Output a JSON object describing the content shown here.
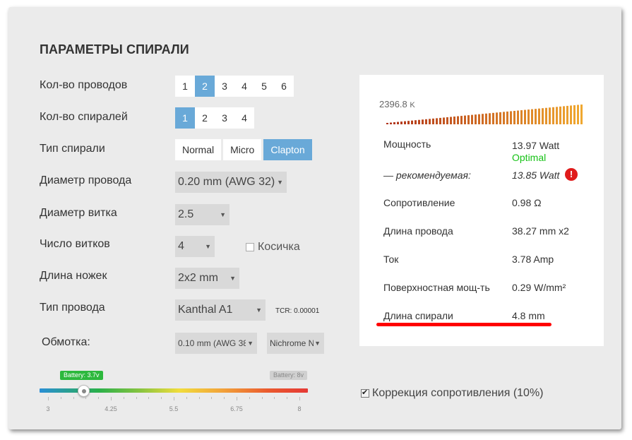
{
  "title": "ПАРАМЕТРЫ СПИРАЛИ",
  "rows": {
    "wires": {
      "label": "Кол-во проводов",
      "options": [
        "1",
        "2",
        "3",
        "4",
        "5",
        "6"
      ],
      "selected": "2"
    },
    "coils": {
      "label": "Кол-во спиралей",
      "options": [
        "1",
        "2",
        "3",
        "4"
      ],
      "selected": "1"
    },
    "coil_type": {
      "label": "Тип спирали",
      "options": [
        "Normal",
        "Micro",
        "Clapton"
      ],
      "selected": "Clapton"
    },
    "wire_diameter": {
      "label": "Диаметр провода",
      "value": "0.20 mm (AWG 32)"
    },
    "coil_diameter": {
      "label": "Диаметр витка",
      "value": "2.5"
    },
    "turns": {
      "label": "Число витков",
      "value": "4"
    },
    "legs": {
      "label": "Длина ножек",
      "value": "2x2 mm"
    },
    "wire_type": {
      "label": "Тип провода",
      "value": "Kanthal A1",
      "tcr": "TCR: 0.00001"
    },
    "wrap": {
      "label": "Обмотка:",
      "diameter": "0.10 mm (AWG 38",
      "material": "Nichrome N"
    }
  },
  "braid": {
    "label": "Косичка",
    "checked": false
  },
  "battery": {
    "current_label": "Battery: 3.7v",
    "max_label": "Battery: 8v",
    "ticks": [
      "3",
      "4.25",
      "5.5",
      "6.75",
      "8"
    ],
    "min": 3,
    "max": 8,
    "value": 3.7
  },
  "correction": {
    "label": "Коррекция сопротивления (10%)",
    "checked": true
  },
  "results": {
    "chart_max_value": "2396.8",
    "chart_max_unit": "K",
    "power": {
      "label": "Мощность",
      "value": "13.97 Watt",
      "status": "Optimal"
    },
    "recommended": {
      "label": "— рекомендуемая:",
      "value": "13.85 Watt",
      "warn": "!"
    },
    "resistance": {
      "label": "Сопротивление",
      "value": "0.98 Ω"
    },
    "wire_length": {
      "label": "Длина провода",
      "value": "38.27 mm x2"
    },
    "current": {
      "label": "Ток",
      "value": "3.78 Amp"
    },
    "surface_power": {
      "label": "Поверхностная мощ-ть",
      "value": "0.29 W/mm²"
    },
    "coil_length": {
      "label": "Длина спирали",
      "value": "4.8 mm"
    }
  },
  "colors": {
    "accent": "#69a9d8",
    "optimal": "#16c216",
    "warning": "#e01b1b",
    "highlight": "#ff0000",
    "bar_dark": "#b0331a",
    "bar_light": "#f0a830"
  },
  "icons": {
    "warning": "exclamation-circle-icon",
    "slider": "slider-thumb"
  }
}
